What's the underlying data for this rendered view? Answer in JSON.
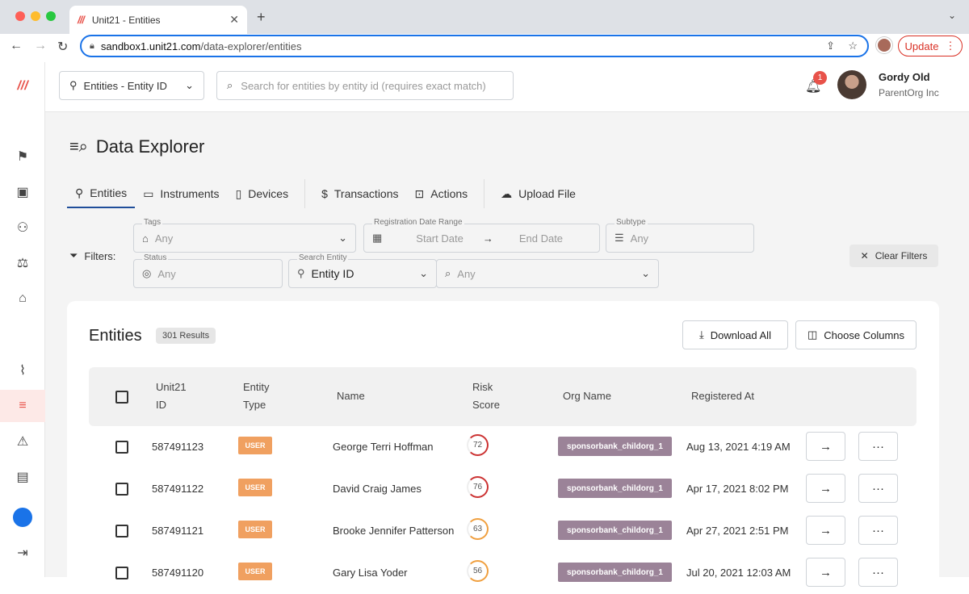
{
  "browser": {
    "tab_title": "Unit21 - Entities",
    "url_host": "sandbox1.unit21.com",
    "url_path": "/data-explorer/entities",
    "update_label": "Update"
  },
  "topbar": {
    "entity_select": "Entities - Entity ID",
    "search_placeholder": "Search for entities by entity id (requires exact match)",
    "notif_count": "1",
    "user_name": "Gordy Old",
    "user_org": "ParentOrg Inc"
  },
  "page": {
    "title": "Data Explorer",
    "tabs": [
      "Entities",
      "Instruments",
      "Devices",
      "Transactions",
      "Actions",
      "Upload File"
    ]
  },
  "filters": {
    "label": "Filters:",
    "tags_label": "Tags",
    "tags_value": "Any",
    "date_label": "Registration Date Range",
    "start": "Start Date",
    "end": "End Date",
    "subtype_label": "Subtype",
    "subtype_value": "Any",
    "status_label": "Status",
    "status_value": "Any",
    "search_entity_label": "Search Entity",
    "search_entity_value": "Entity ID",
    "search_value": "Any",
    "clear_label": "Clear Filters"
  },
  "table": {
    "title": "Entities",
    "results": "301 Results",
    "download": "Download All",
    "columns_btn": "Choose Columns",
    "headers": {
      "id_l1": "Unit21",
      "id_l2": "ID",
      "type_l1": "Entity",
      "type_l2": "Type",
      "name": "Name",
      "risk_l1": "Risk",
      "risk_l2": "Score",
      "org": "Org Name",
      "registered": "Registered At"
    },
    "rows": [
      {
        "id": "587491123",
        "type": "USER",
        "name": "George Terri Hoffman",
        "risk": "72",
        "org": "sponsorbank_childorg_1",
        "registered": "Aug 13, 2021 4:19 AM"
      },
      {
        "id": "587491122",
        "type": "USER",
        "name": "David Craig James",
        "risk": "76",
        "org": "sponsorbank_childorg_1",
        "registered": "Apr 17, 2021 8:02 PM"
      },
      {
        "id": "587491121",
        "type": "USER",
        "name": "Brooke Jennifer Patterson",
        "risk": "63",
        "org": "sponsorbank_childorg_1",
        "registered": "Apr 27, 2021 2:51 PM"
      },
      {
        "id": "587491120",
        "type": "USER",
        "name": "Gary Lisa Yoder",
        "risk": "56",
        "org": "sponsorbank_childorg_1",
        "registered": "Jul 20, 2021 12:03 AM"
      }
    ]
  },
  "colors": {
    "accent": "#e8524a",
    "risk_high": "#cc3333",
    "risk_mid": "#f0a040",
    "user_badge": "#f0a060",
    "org_badge": "#9b8398"
  }
}
